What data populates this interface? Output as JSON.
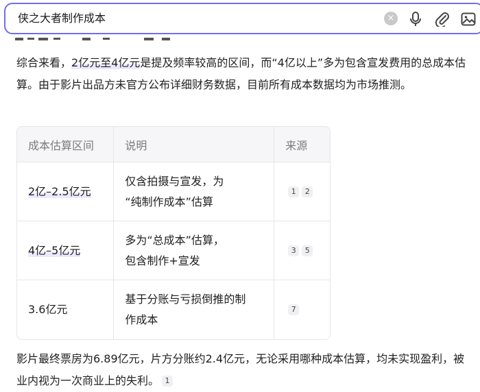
{
  "search": {
    "query": "侠之大者制作成本",
    "clear": "×"
  },
  "summary": {
    "p1_a": "综合来看，",
    "p1_hl": "2亿元至4亿元",
    "p1_b": "是提及频率较高的区间，而“4亿以上”多为包含宣发费用的总成本估算。由于影片出品方未官方公布详细财务数据，目前所有成本数据均为市场推测。"
  },
  "table": {
    "headers": [
      "成本估算区间",
      "说明",
      "来源"
    ],
    "rows": [
      {
        "range": "2亿–2.5亿元",
        "desc_1": "仅含拍摄与宣发，为",
        "desc_2": "“纯制作成本”估算",
        "refs": [
          "1",
          "2"
        ]
      },
      {
        "range": "4亿–5亿元",
        "desc_1": "多为“总成本”估算，",
        "desc_2": "包含制作+宣发",
        "refs": [
          "3",
          "5"
        ]
      },
      {
        "range": "3.6亿元",
        "desc_1": "基于分账与亏损倒推的制",
        "desc_2": "作成本",
        "refs": [
          "7"
        ]
      }
    ]
  },
  "footer": {
    "text": "影片最终票房为6.89亿元，片方分账约2.4亿元，无论采用哪种成本估算，均未实现盈利，被业内视为一次商业上的失利。",
    "ref": "1"
  }
}
